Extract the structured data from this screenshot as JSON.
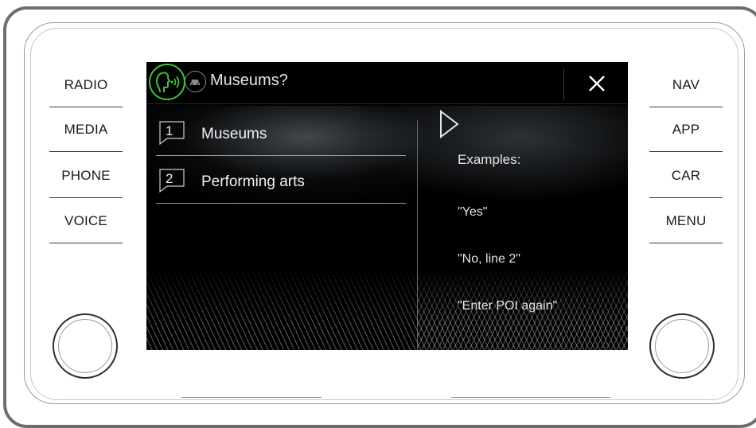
{
  "device": {
    "left_buttons": [
      "RADIO",
      "MEDIA",
      "PHONE",
      "VOICE"
    ],
    "right_buttons": [
      "NAV",
      "APP",
      "CAR",
      "MENU"
    ]
  },
  "screen": {
    "header": {
      "title": "Museums?",
      "voice_icon": "voice-control-icon",
      "secondary_icon": "navigation-car-icon",
      "close_icon": "close-icon"
    },
    "list": [
      {
        "number": "1",
        "label": "Museums"
      },
      {
        "number": "2",
        "label": "Performing arts"
      }
    ],
    "examples": {
      "title": "Examples:",
      "items": [
        "\"Yes\"",
        "\"No, line 2\"",
        "\"Enter POI again\""
      ]
    }
  },
  "colors": {
    "accent_green": "#3cc03c",
    "screen_bg": "#000000",
    "text_light": "#f2f2f2"
  }
}
